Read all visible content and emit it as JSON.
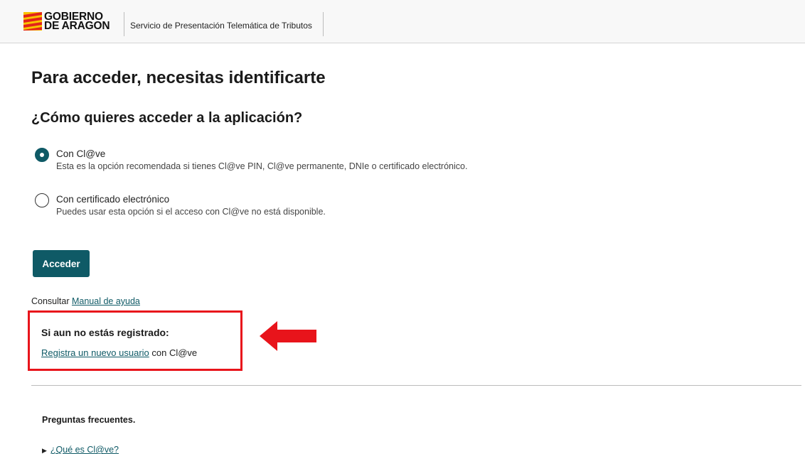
{
  "header": {
    "logo_line1": "GOBIERNO",
    "logo_line2": "DE ARAGON",
    "service_title": "Servicio de Presentación Telemática de Tributos"
  },
  "main": {
    "title": "Para acceder, necesitas identificarte",
    "subtitle": "¿Cómo quieres acceder a la aplicación?",
    "options": [
      {
        "label": "Con Cl@ve",
        "description": "Esta es la opción recomendada si tienes Cl@ve PIN, Cl@ve permanente, DNIe o certificado electrónico.",
        "selected": true
      },
      {
        "label": "Con certificado electrónico",
        "description": "Puedes usar esta opción si el acceso con Cl@ve no está disponible.",
        "selected": false
      }
    ],
    "submit_label": "Acceder",
    "help_prefix": "Consultar",
    "help_link": "Manual de ayuda"
  },
  "register": {
    "title": "Si aun no estás registrado:",
    "link": "Registra un nuevo usuario",
    "suffix": " con Cl@ve"
  },
  "faq": {
    "title": "Preguntas frecuentes.",
    "items": [
      "¿Qué es Cl@ve?"
    ]
  },
  "colors": {
    "accent": "#0f5a66",
    "highlight_border": "#e8141b",
    "logo_yellow": "#f9c200",
    "logo_red": "#e2231a"
  },
  "icons": {
    "logo": "aragon-flag-stripes",
    "arrow": "red-left-arrow",
    "faq_bullet": "triangle-right-icon"
  }
}
